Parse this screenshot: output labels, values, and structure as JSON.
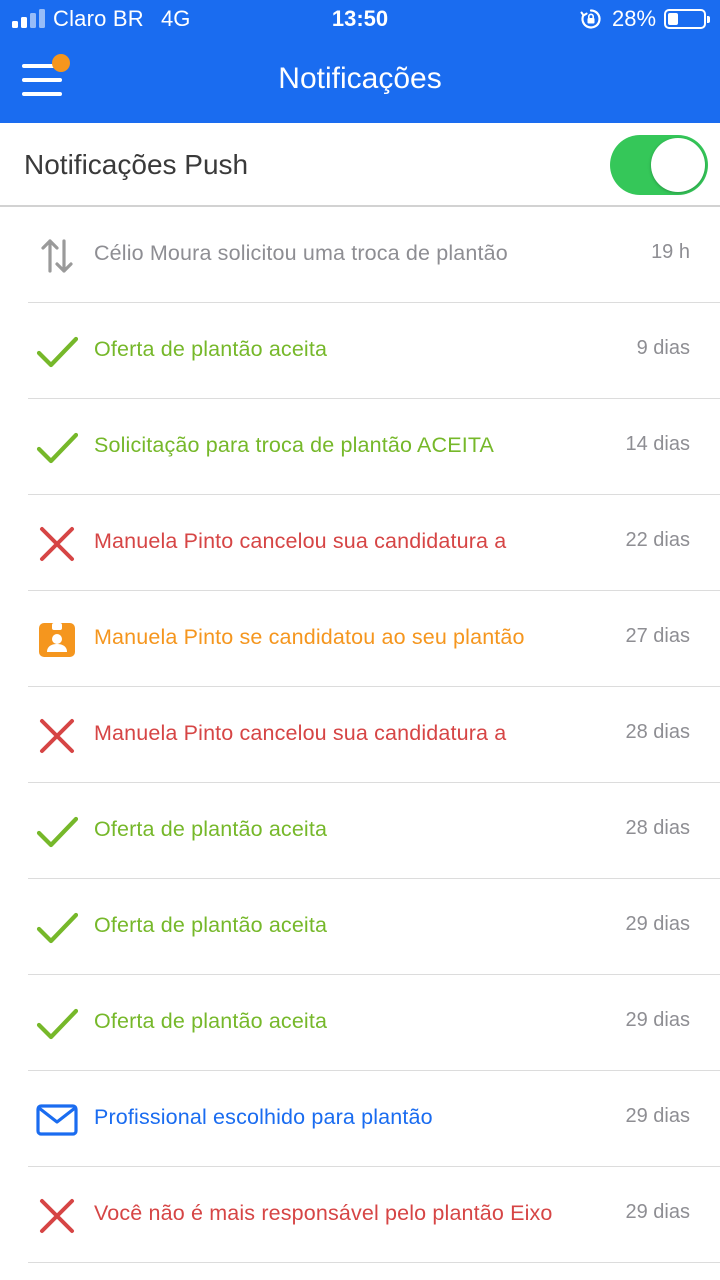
{
  "status_bar": {
    "carrier": "Claro BR",
    "network": "4G",
    "time": "13:50",
    "battery_percent": "28%",
    "battery_level": 0.28,
    "signal_bars": 2
  },
  "header": {
    "title": "Notificações",
    "menu_icon": "hamburger-menu-icon",
    "badge_color": "#f5961e",
    "background_color": "#1a6cf0"
  },
  "push_setting": {
    "label": "Notificações Push",
    "enabled": true,
    "toggle_color": "#35c759"
  },
  "notifications": [
    {
      "icon": "swap-arrows-icon",
      "type": "swap",
      "text": "Célio Moura solicitou uma troca de plantão",
      "time": "19 h",
      "color": "#8e8e93"
    },
    {
      "icon": "checkmark-icon",
      "type": "accepted",
      "text": "Oferta de plantão aceita",
      "time": "9 dias",
      "color": "#76b82a"
    },
    {
      "icon": "checkmark-icon",
      "type": "accepted",
      "text": "Solicitação para troca de plantão ACEITA",
      "time": "14 dias",
      "color": "#76b82a"
    },
    {
      "icon": "cross-icon",
      "type": "cancelled",
      "text": "Manuela Pinto cancelou sua candidatura a",
      "time": "22 dias",
      "color": "#d64545"
    },
    {
      "icon": "id-badge-icon",
      "type": "candidate",
      "text": "Manuela Pinto se candidatou ao seu plantão",
      "time": "27 dias",
      "color": "#f5961e"
    },
    {
      "icon": "cross-icon",
      "type": "cancelled",
      "text": "Manuela Pinto cancelou sua candidatura a",
      "time": "28 dias",
      "color": "#d64545"
    },
    {
      "icon": "checkmark-icon",
      "type": "accepted",
      "text": "Oferta de plantão aceita",
      "time": "28 dias",
      "color": "#76b82a"
    },
    {
      "icon": "checkmark-icon",
      "type": "accepted",
      "text": "Oferta de plantão aceita",
      "time": "29 dias",
      "color": "#76b82a"
    },
    {
      "icon": "checkmark-icon",
      "type": "accepted",
      "text": "Oferta de plantão aceita",
      "time": "29 dias",
      "color": "#76b82a"
    },
    {
      "icon": "envelope-icon",
      "type": "chosen",
      "text": "Profissional escolhido para plantão",
      "time": "29 dias",
      "color": "#1a6cf0"
    },
    {
      "icon": "cross-icon",
      "type": "cancelled",
      "text": "Você não é mais responsável pelo plantão Eixo",
      "time": "29 dias",
      "color": "#d64545"
    }
  ]
}
